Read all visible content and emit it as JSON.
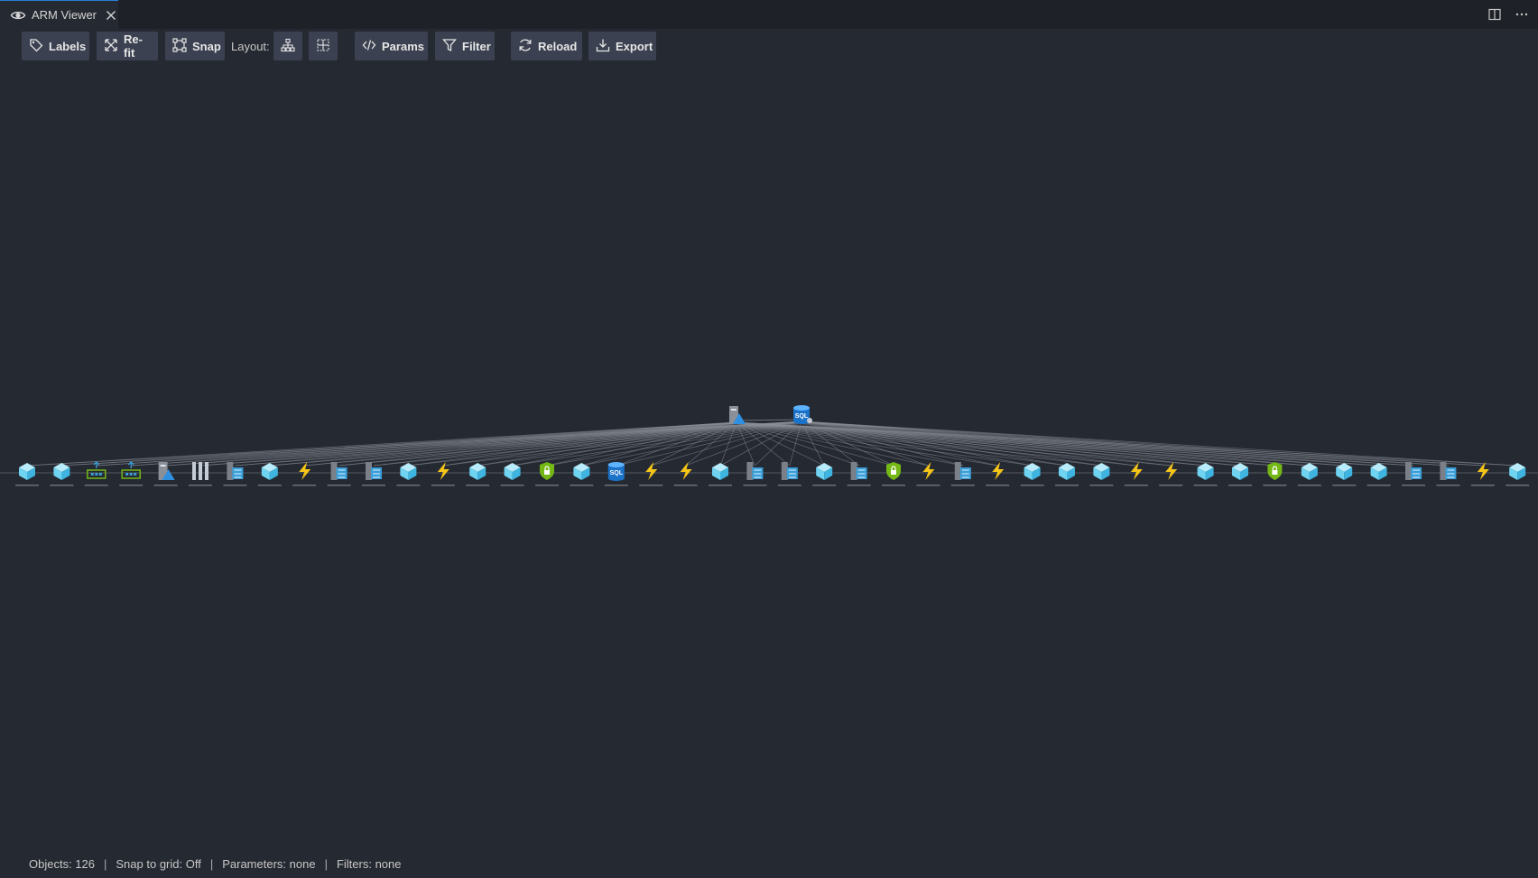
{
  "tab": {
    "title": "ARM Viewer"
  },
  "toolbar": {
    "labels": "Labels",
    "refit": "Re-fit",
    "snap": "Snap",
    "layout_label": "Layout:",
    "params": "Params",
    "filter": "Filter",
    "reload": "Reload",
    "export": "Export"
  },
  "status": {
    "objects": "Objects: 126",
    "snap": "Snap to grid: Off",
    "parameters": "Parameters: none",
    "filters": "Filters: none",
    "separator": "|"
  },
  "colors": {
    "background": "#252932",
    "tabbar": "#1e2127",
    "button": "#3b4150",
    "edge": "#8a8f98",
    "cube": "#6fd3f2",
    "bolt": "#f5c518",
    "shield": "#74b816",
    "sql": "#1b73c9"
  },
  "graph": {
    "hubs": [
      "server-icon",
      "sql-server-icon"
    ],
    "row": [
      "cube",
      "cube",
      "gateway",
      "gateway",
      "server",
      "config",
      "list",
      "cube",
      "bolt",
      "list",
      "list",
      "cube",
      "bolt",
      "cube",
      "cube",
      "shield",
      "cube",
      "sql",
      "bolt",
      "bolt",
      "cube",
      "list",
      "list",
      "cube",
      "list",
      "shield",
      "bolt",
      "list",
      "bolt",
      "cube",
      "cube",
      "cube",
      "bolt",
      "bolt",
      "cube",
      "cube",
      "shield",
      "cube",
      "cube",
      "cube",
      "list",
      "list",
      "bolt",
      "cube"
    ]
  }
}
